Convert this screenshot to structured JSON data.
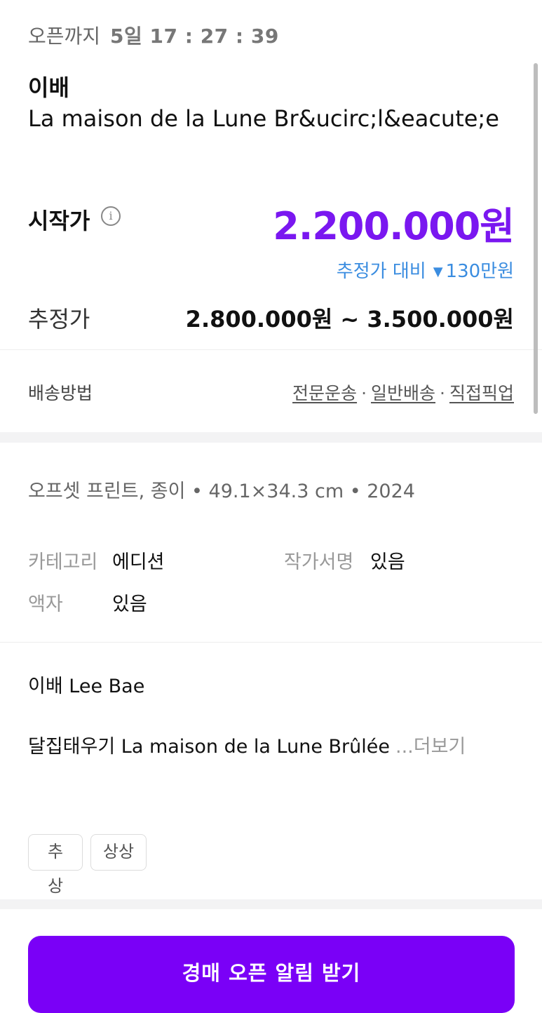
{
  "countdown": {
    "label": "오픈까지",
    "time": "5일 17 : 27 : 39"
  },
  "artwork": {
    "artist": "이배",
    "title": "La maison de la Lune Br&ucirc;l&eacute;e"
  },
  "pricing": {
    "start_label": "시작가",
    "info_icon": "info-icon",
    "start_price": "2.200.000원",
    "compare_label": "추정가 대비",
    "compare_icon": "▼",
    "compare_value": "130만원",
    "estimate_label": "추정가",
    "estimate_value": "2.800.000원 ~ 3.500.000원"
  },
  "shipping": {
    "label": "배송방법",
    "methods": [
      "전문운송",
      "일반배송",
      "직접픽업"
    ],
    "separator": "·"
  },
  "specs": {
    "line": "오프셋 프린트, 종이 • 49.1×34.3 cm • 2024"
  },
  "attributes": [
    {
      "label": "카테고리",
      "value": "에디션"
    },
    {
      "label": "작가서명",
      "value": "있음"
    },
    {
      "label": "액자",
      "value": "있음"
    }
  ],
  "description": {
    "author": "이배 Lee Bae",
    "text": "달집태우기 La maison de la Lune Brûlée",
    "more": "...더보기"
  },
  "tags": [
    "추상",
    "상상"
  ],
  "cta": {
    "label": "경매 오픈 알림 받기"
  },
  "colors": {
    "accent": "#7a00f7",
    "price": "#7a17f0",
    "compare_blue": "#3b8de0"
  }
}
